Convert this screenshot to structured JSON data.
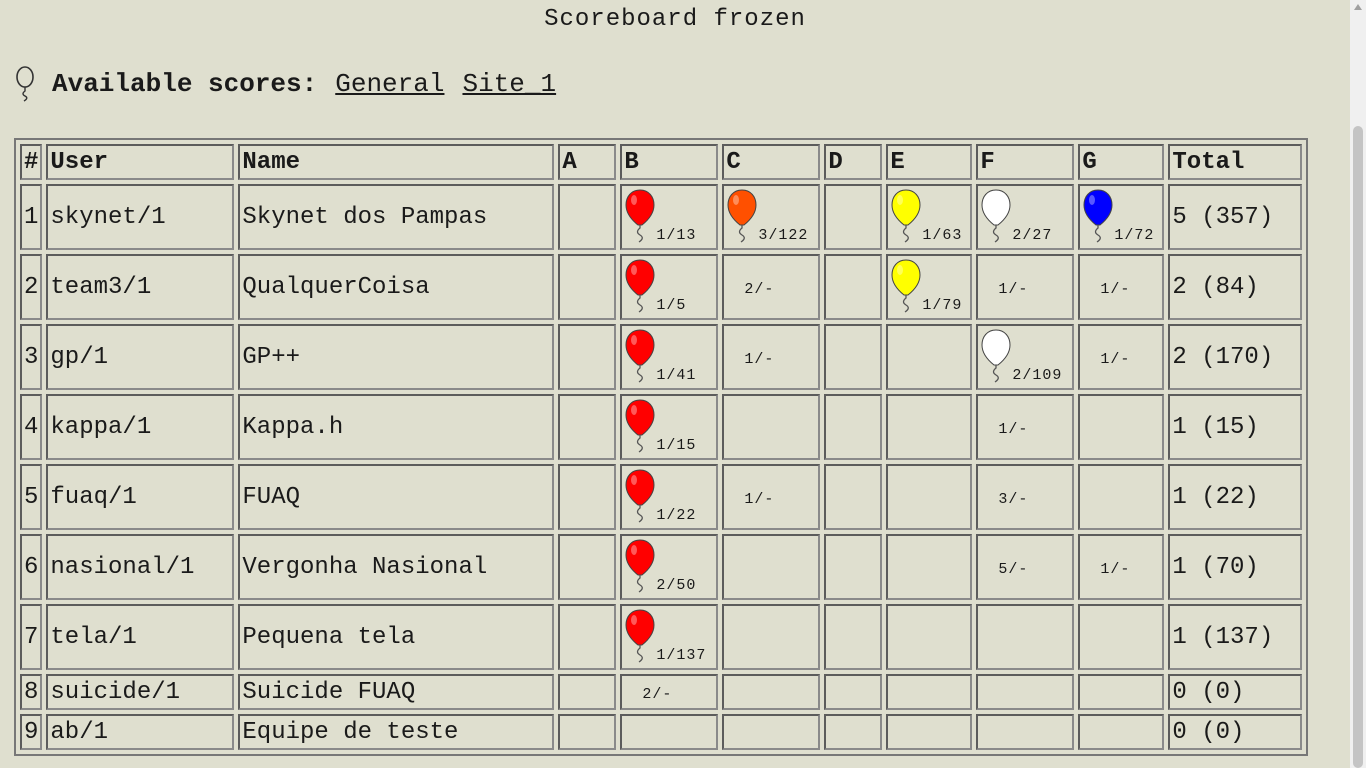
{
  "header": {
    "title": "Scoreboard frozen"
  },
  "scores_nav": {
    "label": "Available scores:",
    "links": [
      {
        "label": "General"
      },
      {
        "label": "Site_1"
      }
    ]
  },
  "table": {
    "columns": [
      "#",
      "User",
      "Name",
      "A",
      "B",
      "C",
      "D",
      "E",
      "F",
      "G",
      "Total"
    ],
    "problem_colors": {
      "B": "#ff0000",
      "C": "#ff5000",
      "E": "#ffff00",
      "F": "#ffffff",
      "G": "#0000ff"
    },
    "rows": [
      {
        "rank": "1",
        "user": "skynet/1",
        "name": "Skynet dos Pampas",
        "total": "5 (357)",
        "cells": {
          "A": "",
          "B": "1/13",
          "C": "3/122",
          "D": "",
          "E": "1/63",
          "F": "2/27",
          "G": "1/72"
        },
        "solved": [
          "B",
          "C",
          "E",
          "F",
          "G"
        ]
      },
      {
        "rank": "2",
        "user": "team3/1",
        "name": "QualquerCoisa",
        "total": "2 (84)",
        "cells": {
          "A": "",
          "B": "1/5",
          "C": "2/-",
          "D": "",
          "E": "1/79",
          "F": "1/-",
          "G": "1/-"
        },
        "solved": [
          "B",
          "E"
        ]
      },
      {
        "rank": "3",
        "user": "gp/1",
        "name": "GP++",
        "total": "2 (170)",
        "cells": {
          "A": "",
          "B": "1/41",
          "C": "1/-",
          "D": "",
          "E": "",
          "F": "2/109",
          "G": "1/-"
        },
        "solved": [
          "B",
          "F"
        ]
      },
      {
        "rank": "4",
        "user": "kappa/1",
        "name": "Kappa.h",
        "total": "1 (15)",
        "cells": {
          "A": "",
          "B": "1/15",
          "C": "",
          "D": "",
          "E": "",
          "F": "1/-",
          "G": ""
        },
        "solved": [
          "B"
        ]
      },
      {
        "rank": "5",
        "user": "fuaq/1",
        "name": "FUAQ",
        "total": "1 (22)",
        "cells": {
          "A": "",
          "B": "1/22",
          "C": "1/-",
          "D": "",
          "E": "",
          "F": "3/-",
          "G": ""
        },
        "solved": [
          "B"
        ]
      },
      {
        "rank": "6",
        "user": "nasional/1",
        "name": "Vergonha Nasional",
        "total": "1 (70)",
        "cells": {
          "A": "",
          "B": "2/50",
          "C": "",
          "D": "",
          "E": "",
          "F": "5/-",
          "G": "1/-"
        },
        "solved": [
          "B"
        ]
      },
      {
        "rank": "7",
        "user": "tela/1",
        "name": "Pequena tela",
        "total": "1 (137)",
        "cells": {
          "A": "",
          "B": "1/137",
          "C": "",
          "D": "",
          "E": "",
          "F": "",
          "G": ""
        },
        "solved": [
          "B"
        ]
      },
      {
        "rank": "8",
        "user": "suicide/1",
        "name": "Suicide FUAQ",
        "total": "0 (0)",
        "cells": {
          "A": "",
          "B": "2/-",
          "C": "",
          "D": "",
          "E": "",
          "F": "",
          "G": ""
        },
        "solved": []
      },
      {
        "rank": "9",
        "user": "ab/1",
        "name": "Equipe de teste",
        "total": "0 (0)",
        "cells": {
          "A": "",
          "B": "",
          "C": "",
          "D": "",
          "E": "",
          "F": "",
          "G": ""
        },
        "solved": []
      }
    ]
  },
  "icons": {
    "bulb": "balloon-outline-icon",
    "solved": "balloon-icon"
  }
}
